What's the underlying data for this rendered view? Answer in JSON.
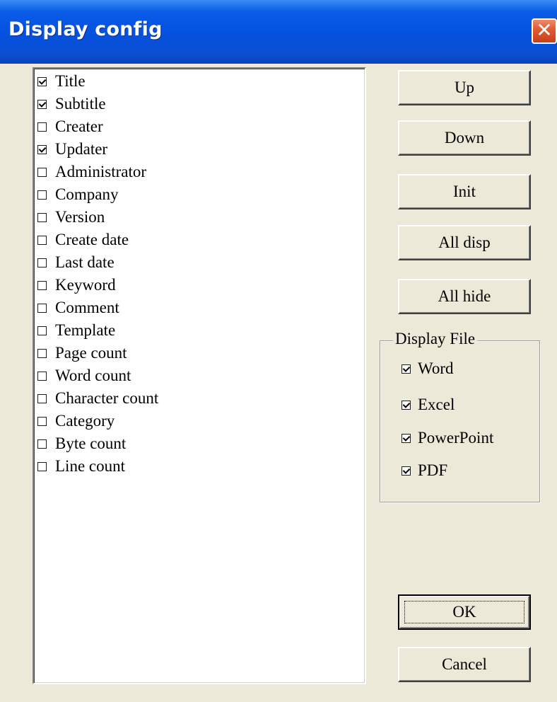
{
  "window": {
    "title": "Display config",
    "close_glyph": "✕"
  },
  "items": [
    {
      "label": "Title",
      "checked": true
    },
    {
      "label": "Subtitle",
      "checked": true
    },
    {
      "label": "Creater",
      "checked": false
    },
    {
      "label": "Updater",
      "checked": true
    },
    {
      "label": "Administrator",
      "checked": false
    },
    {
      "label": "Company",
      "checked": false
    },
    {
      "label": "Version",
      "checked": false
    },
    {
      "label": "Create date",
      "checked": false
    },
    {
      "label": "Last date",
      "checked": false
    },
    {
      "label": "Keyword",
      "checked": false
    },
    {
      "label": "Comment",
      "checked": false
    },
    {
      "label": "Template",
      "checked": false
    },
    {
      "label": "Page count",
      "checked": false
    },
    {
      "label": "Word count",
      "checked": false
    },
    {
      "label": "Character count",
      "checked": false
    },
    {
      "label": "Category",
      "checked": false
    },
    {
      "label": "Byte count",
      "checked": false
    },
    {
      "label": "Line count",
      "checked": false
    }
  ],
  "buttons": {
    "up": "Up",
    "down": "Down",
    "init": "Init",
    "all_disp": "All disp",
    "all_hide": "All hide",
    "ok": "OK",
    "cancel": "Cancel"
  },
  "display_file": {
    "legend": "Display File",
    "options": [
      {
        "label": "Word",
        "checked": true
      },
      {
        "label": "Excel",
        "checked": true
      },
      {
        "label": "PowerPoint",
        "checked": true
      },
      {
        "label": "PDF",
        "checked": true
      }
    ]
  }
}
